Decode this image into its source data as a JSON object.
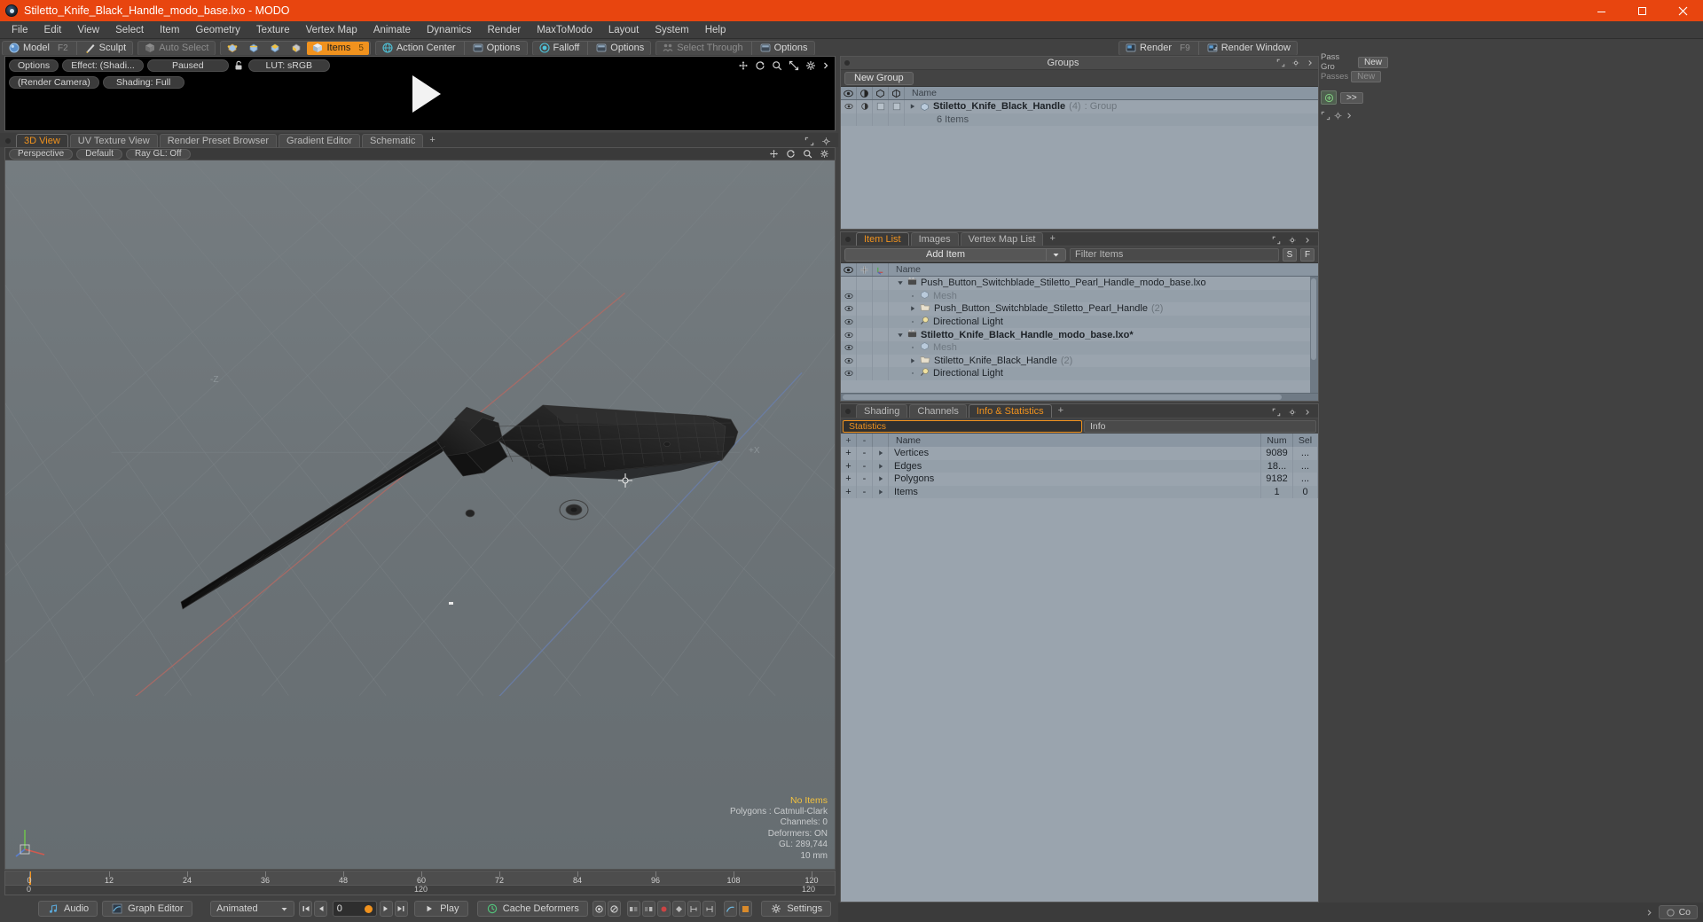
{
  "window": {
    "title": "Stiletto_Knife_Black_Handle_modo_base.lxo - MODO",
    "minimize": "—",
    "maximize": "❐",
    "close": "✕"
  },
  "menubar": {
    "items": [
      "File",
      "Edit",
      "View",
      "Select",
      "Item",
      "Geometry",
      "Texture",
      "Vertex Map",
      "Animate",
      "Dynamics",
      "Render",
      "MaxToModo",
      "Layout",
      "System",
      "Help"
    ]
  },
  "modebar": {
    "model_label": "Model",
    "model_hotkey": "F2",
    "sculpt_label": "Sculpt",
    "auto_select_label": "Auto Select",
    "items_label": "Items",
    "items_hotkey": "5",
    "action_center_label": "Action Center",
    "options_label": "Options",
    "falloff_label": "Falloff",
    "options2_label": "Options",
    "select_through_label": "Select Through",
    "options3_label": "Options",
    "render_label": "Render",
    "render_hotkey": "F9",
    "render_window_label": "Render Window"
  },
  "preview": {
    "options_label": "Options",
    "effect_label": "Effect: (Shadi...",
    "paused_label": "Paused",
    "lut_label": "LUT: sRGB",
    "camera_label": "(Render Camera)",
    "shading_label": "Shading: Full"
  },
  "viewtabs": {
    "tabs": [
      {
        "label": "3D View",
        "selected": true
      },
      {
        "label": "UV Texture View",
        "selected": false
      },
      {
        "label": "Render Preset Browser",
        "selected": false
      },
      {
        "label": "Gradient Editor",
        "selected": false
      },
      {
        "label": "Schematic",
        "selected": false
      }
    ],
    "add_label": "+"
  },
  "viewport": {
    "perspective_label": "Perspective",
    "default_label": "Default",
    "raygl_label": "Ray GL: Off",
    "axis_x_label": "+X",
    "axis_z_label": "-Z",
    "info": {
      "no_items": "No Items",
      "polygons": "Polygons : Catmull-Clark",
      "channels": "Channels: 0",
      "deformers": "Deformers: ON",
      "gl": "GL: 289,744",
      "scale": "10 mm"
    },
    "gizmo": {
      "x": "X",
      "y": "Y",
      "z": "Z"
    }
  },
  "timeline": {
    "ticks": [
      0,
      12,
      24,
      36,
      48,
      60,
      72,
      84,
      96,
      108,
      120
    ],
    "range_start": "0",
    "range_mid": "120",
    "range_end": "120"
  },
  "bottombar": {
    "audio_label": "Audio",
    "graph_editor_label": "Graph Editor",
    "animated_label": "Animated",
    "frame_value": "0",
    "play_label": "Play",
    "cache_deformers_label": "Cache Deformers",
    "settings_label": "Settings"
  },
  "groups_panel": {
    "title": "Groups",
    "new_group_label": "New Group",
    "columns": [
      "eye-col",
      "shade-col",
      "poly-col",
      "wire-col",
      "Name"
    ],
    "name_header": "Name",
    "rows": [
      {
        "name": "Stiletto_Knife_Black_Handle",
        "count": "(4)",
        "type": ": Group",
        "sub": "6 Items",
        "bold": true
      }
    ]
  },
  "itemlist_panel": {
    "tabs": [
      {
        "label": "Item List",
        "selected": true
      },
      {
        "label": "Images",
        "selected": false
      },
      {
        "label": "Vertex Map List",
        "selected": false
      }
    ],
    "add_tab_label": "+",
    "add_item_label": "Add Item",
    "filter_placeholder": "Filter Items",
    "filter_s": "S",
    "filter_f": "F",
    "name_header": "Name",
    "rows": [
      {
        "name": "Push_Button_Switchblade_Stiletto_Pearl_Handle_modo_base.lxo",
        "icon": "scene-icon",
        "indent": 0,
        "twisty": "down",
        "bold": false,
        "eye": false,
        "count": ""
      },
      {
        "name": "Mesh",
        "icon": "mesh-icon",
        "indent": 1,
        "twisty": "none",
        "bold": false,
        "eye": true,
        "count": "",
        "muted": true
      },
      {
        "name": "Push_Button_Switchblade_Stiletto_Pearl_Handle",
        "icon": "folder-icon",
        "indent": 1,
        "twisty": "right",
        "bold": false,
        "eye": true,
        "count": "(2)"
      },
      {
        "name": "Directional Light",
        "icon": "light-icon",
        "indent": 1,
        "twisty": "none",
        "bold": false,
        "eye": true,
        "count": ""
      },
      {
        "name": "Stiletto_Knife_Black_Handle_modo_base.lxo*",
        "icon": "scene-icon",
        "indent": 0,
        "twisty": "down",
        "bold": true,
        "eye": true,
        "count": ""
      },
      {
        "name": "Mesh",
        "icon": "mesh-icon",
        "indent": 1,
        "twisty": "none",
        "bold": false,
        "eye": true,
        "count": "",
        "muted": true
      },
      {
        "name": "Stiletto_Knife_Black_Handle",
        "icon": "folder-icon",
        "indent": 1,
        "twisty": "right",
        "bold": false,
        "eye": true,
        "count": "(2)"
      },
      {
        "name": "Directional Light",
        "icon": "light-icon",
        "indent": 1,
        "twisty": "none",
        "bold": false,
        "eye": true,
        "count": ""
      }
    ]
  },
  "info_panel": {
    "tabs": [
      {
        "label": "Shading",
        "selected": false
      },
      {
        "label": "Channels",
        "selected": false
      },
      {
        "label": "Info & Statistics",
        "selected": true
      }
    ],
    "add_tab_label": "+",
    "statistics_label": "Statistics",
    "info_label": "Info",
    "columns": {
      "plus": "+",
      "minus": "-",
      "arrow": "",
      "name": "Name",
      "num": "Num",
      "sel": "Sel"
    },
    "rows": [
      {
        "plus": "+",
        "minus": "-",
        "name": "Vertices",
        "num": "9089",
        "sel": "..."
      },
      {
        "plus": "+",
        "minus": "-",
        "name": "Edges",
        "num": "18...",
        "sel": "..."
      },
      {
        "plus": "+",
        "minus": "-",
        "name": "Polygons",
        "num": "9182",
        "sel": "..."
      },
      {
        "plus": "+",
        "minus": "-",
        "name": "Items",
        "num": "1",
        "sel": "0"
      }
    ]
  },
  "rail": {
    "pass_group_label": "Pass Gro",
    "new_label": "New",
    "passes_label": "Passes",
    "new2_label": "New",
    "forward_label": ">>",
    "co_label": "Co"
  },
  "colors": {
    "title_bar": "#e8450f",
    "accent": "#f0921e",
    "panel_bg": "#3d3d3d",
    "list_bg": "#9aa4ae",
    "list_header": "#8a96a2",
    "viewport_bg": "#6d7478"
  }
}
